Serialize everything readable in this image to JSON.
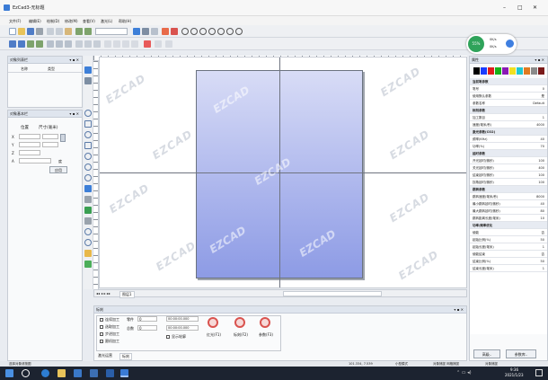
{
  "window": {
    "title": "EzCad3-无标题",
    "controls": [
      "–",
      "□",
      "✕"
    ]
  },
  "menu": [
    "文件(F)",
    "编辑(E)",
    "绘制(D)",
    "修改(M)",
    "查看(V)",
    "激光(L)",
    "帮助(H)"
  ],
  "toolbar": {
    "zoom_value": "200",
    "zoom_unit": "%"
  },
  "left_panel": {
    "title": "对象列表栏",
    "col_name": "名称",
    "col_type": "类型"
  },
  "obj_panel": {
    "title": "对象基本栏",
    "col_pos": "位置",
    "col_size": "尺寸(毫米)",
    "rows": [
      "X",
      "Y",
      "Z",
      "A"
    ],
    "apply_btn": "应用",
    "degree": "度"
  },
  "canvas": {
    "watermark": "EZCAD"
  },
  "status_tabs": [
    "图层1"
  ],
  "bottom": {
    "title": "标刻",
    "checks": [
      "连续加工",
      "选取加工",
      "步进加工",
      "跟机加工"
    ],
    "part_label": "零件",
    "part_value": "0",
    "total_label": "总数",
    "total_value": "0",
    "time1": "00:00:00.000",
    "time2": "00:00:00.000",
    "show_area": "显示轮廓",
    "buttons": [
      {
        "label": "红光(F1)"
      },
      {
        "label": "标刻(F2)"
      },
      {
        "label": "参数(F3)"
      }
    ],
    "tabs": [
      "激光运营",
      "标刻"
    ]
  },
  "right": {
    "title": "属性",
    "sections": [
      {
        "title": "当前笔参数",
        "rows": [
          [
            "笔号",
            "0"
          ],
          [
            "使用默认参数",
            "是"
          ],
          [
            "参数名称",
            "Default"
          ]
        ]
      },
      {
        "title": "标刻参数",
        "rows": [
          [
            "加工数目",
            "1"
          ],
          [
            "速度(毫米/秒)",
            "4000"
          ]
        ]
      },
      {
        "title": "激光参数(CO2)",
        "rows": [
          [
            "频率(KHz)",
            "40"
          ],
          [
            "功率(%)",
            "70"
          ]
        ]
      },
      {
        "title": "延时参数",
        "rows": [
          [
            "开光延时(微秒)",
            "100"
          ],
          [
            "关光延时(微秒)",
            "400"
          ],
          [
            "结束延时(微秒)",
            "100"
          ],
          [
            "拐角延时(微秒)",
            "100"
          ]
        ]
      },
      {
        "title": "跳转参数",
        "rows": [
          [
            "跳转速度(毫米/秒)",
            "8000"
          ],
          [
            "最小跳转延时(微秒)",
            "40"
          ],
          [
            "最大跳转延时(微秒)",
            "80"
          ],
          [
            "跳转距离长度(毫米)",
            "10"
          ]
        ]
      },
      {
        "title": "功率/频率优化",
        "rows": [
          [
            "使能",
            "否"
          ],
          [
            "起始比例(%)",
            "50"
          ],
          [
            "起始长度(毫米)",
            "1"
          ],
          [
            "使能结束",
            "否"
          ],
          [
            "结束比例(%)",
            "50"
          ],
          [
            "结束长度(毫米)",
            "1"
          ]
        ]
      }
    ],
    "btn1": "高级..",
    "btn2": "参数库.."
  },
  "statusbar": {
    "left": "选择对象请按图",
    "coord": "101.334, 7.539",
    "extra1": "小型模式",
    "extra2": "对象捕捉 网格捕捉",
    "extra3": "对象捕捉"
  },
  "badge": {
    "up": "0K/s",
    "down": "0K/s",
    "percent": "55%"
  },
  "clock": {
    "time": "9:36",
    "date": "2021/1/23"
  }
}
